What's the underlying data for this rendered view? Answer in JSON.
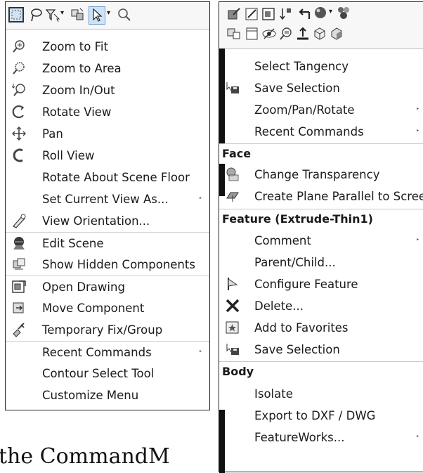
{
  "left_menu": {
    "items": [
      {
        "label": "Zoom to Fit"
      },
      {
        "label": "Zoom to Area"
      },
      {
        "label": "Zoom In/Out"
      },
      {
        "label": "Rotate View"
      },
      {
        "label": "Pan"
      },
      {
        "label": "Roll View"
      },
      {
        "label": "Rotate About Scene Floor"
      },
      {
        "label": "Set Current View As...",
        "submenu_arrow": "‣"
      },
      {
        "label": "View Orientation..."
      },
      {
        "label": "Edit Scene"
      },
      {
        "label": "Show Hidden Components"
      },
      {
        "label": "Open Drawing"
      },
      {
        "label": "Move Component"
      },
      {
        "label": "Temporary Fix/Group"
      },
      {
        "label": "Recent Commands",
        "submenu_arrow": "‣"
      },
      {
        "label": "Contour Select Tool"
      },
      {
        "label": "Customize Menu"
      }
    ]
  },
  "right_menu": {
    "top_items": [
      {
        "label": "Select Tangency"
      },
      {
        "label": "Save Selection"
      },
      {
        "label": "Zoom/Pan/Rotate",
        "submenu_arrow": "‣"
      },
      {
        "label": "Recent Commands",
        "submenu_arrow": "‣"
      }
    ],
    "face_section": {
      "title": "Face",
      "items": [
        {
          "label": "Change Transparency"
        },
        {
          "label": "Create Plane Parallel to Screen"
        }
      ]
    },
    "feature_section": {
      "title": "Feature (Extrude-Thin1)",
      "items": [
        {
          "label": "Comment",
          "submenu_arrow": "‣"
        },
        {
          "label": "Parent/Child..."
        },
        {
          "label": "Configure Feature"
        },
        {
          "label": "Delete..."
        },
        {
          "label": "Add to Favorites"
        },
        {
          "label": "Save Selection"
        }
      ]
    },
    "body_section": {
      "title": "Body",
      "items": [
        {
          "label": "Isolate"
        },
        {
          "label": "Export to DXF / DWG"
        },
        {
          "label": "FeatureWorks...",
          "submenu_arrow": "‣"
        }
      ]
    }
  },
  "caption": "the CommandM"
}
